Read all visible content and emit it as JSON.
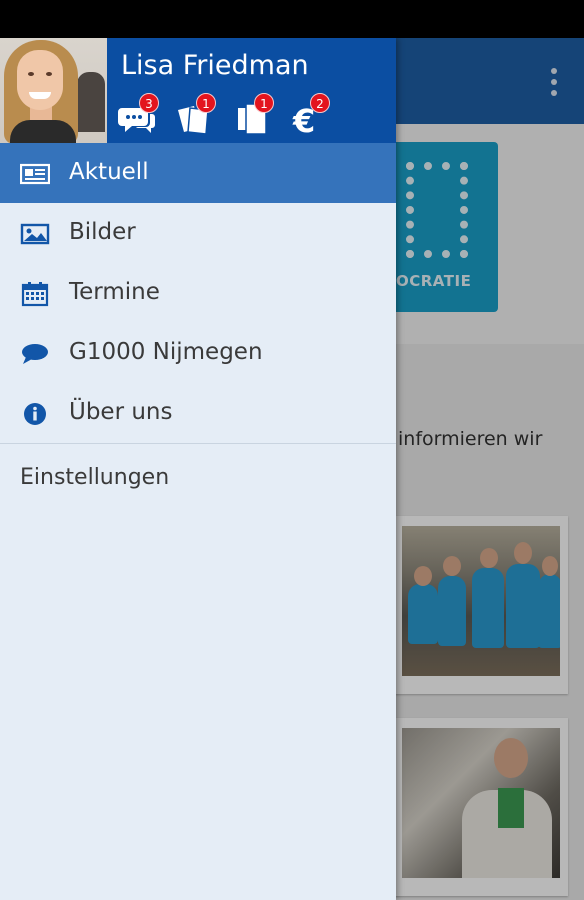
{
  "user": {
    "name": "Lisa Friedman"
  },
  "header_icons": [
    {
      "name": "chat-bubbles-icon",
      "badge": "3"
    },
    {
      "name": "tickets-icon",
      "badge": "1"
    },
    {
      "name": "documents-icon",
      "badge": "1"
    },
    {
      "name": "euro-icon",
      "badge": "2"
    }
  ],
  "menu": {
    "items": [
      {
        "label": "Aktuell",
        "icon": "newspaper-icon",
        "active": true
      },
      {
        "label": "Bilder",
        "icon": "picture-icon",
        "active": false
      },
      {
        "label": "Termine",
        "icon": "calendar-icon",
        "active": false
      },
      {
        "label": "G1000 Nijmegen",
        "icon": "speech-bubble-icon",
        "active": false
      },
      {
        "label": "Über uns",
        "icon": "info-icon",
        "active": false
      }
    ],
    "settings_label": "Einstellungen"
  },
  "background": {
    "logo_text": "OCRATIE",
    "intro_text": "informieren wir"
  },
  "colors": {
    "header": "#0b4ea2",
    "active_item": "#3573bb",
    "drawer_bg": "#e5edf6",
    "icon_blue": "#1256a8",
    "badge": "#e3141e"
  }
}
